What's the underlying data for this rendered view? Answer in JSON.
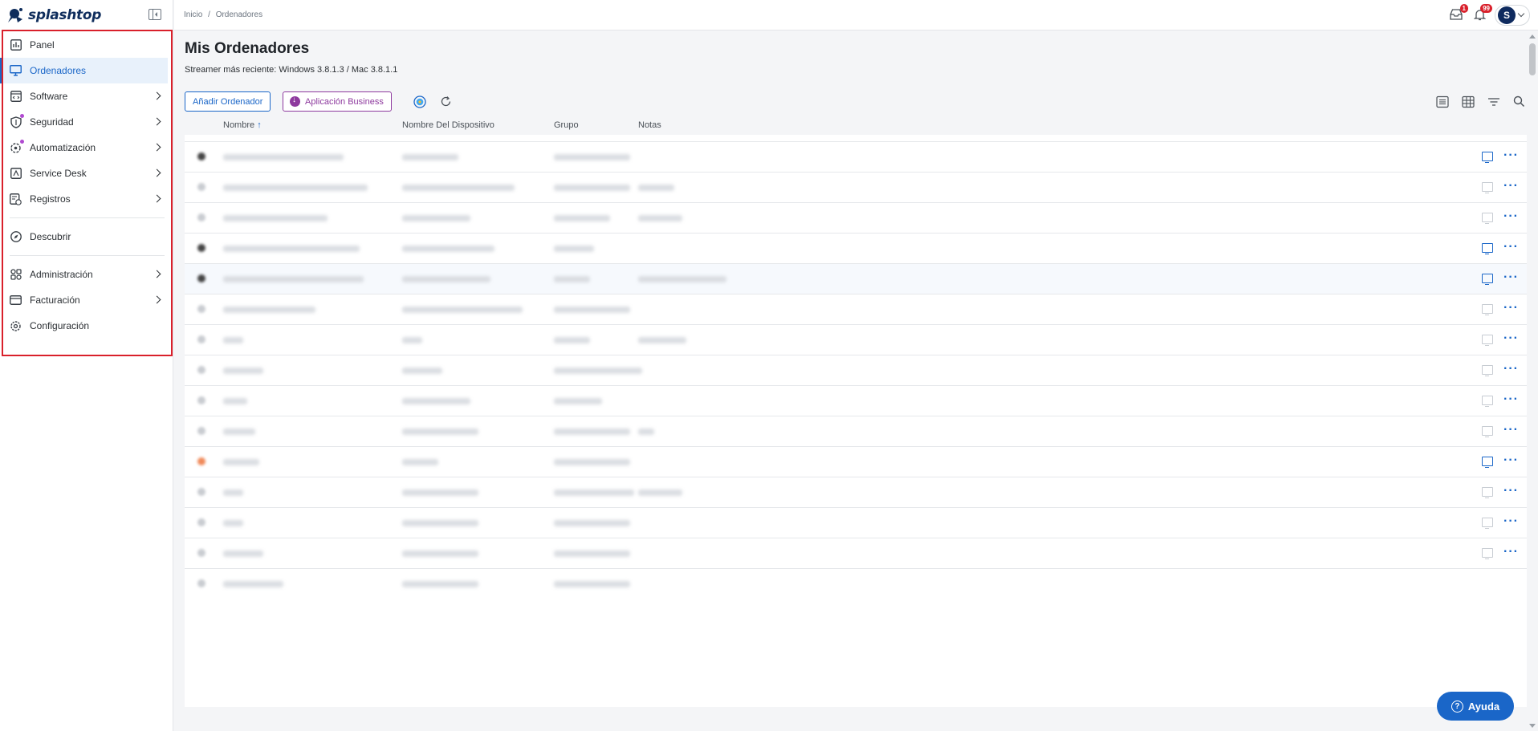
{
  "brand": {
    "name": "splashtop"
  },
  "sidebar": {
    "items": [
      {
        "label": "Panel",
        "icon": "chart-icon",
        "active": false,
        "has_chevron": false
      },
      {
        "label": "Ordenadores",
        "icon": "monitor-icon",
        "active": true,
        "has_chevron": false
      },
      {
        "label": "Software",
        "icon": "code-window-icon",
        "active": false,
        "has_chevron": true
      },
      {
        "label": "Seguridad",
        "icon": "shield-icon",
        "active": false,
        "has_chevron": true
      },
      {
        "label": "Automatización",
        "icon": "automation-icon",
        "active": false,
        "has_chevron": true
      },
      {
        "label": "Service Desk",
        "icon": "service-desk-icon",
        "active": false,
        "has_chevron": true
      },
      {
        "label": "Registros",
        "icon": "logs-icon",
        "active": false,
        "has_chevron": true
      },
      {
        "label": "Descubrir",
        "icon": "compass-icon",
        "active": false,
        "has_chevron": false
      },
      {
        "label": "Administración",
        "icon": "admin-icon",
        "active": false,
        "has_chevron": true
      },
      {
        "label": "Facturación",
        "icon": "card-icon",
        "active": false,
        "has_chevron": true
      },
      {
        "label": "Configuración",
        "icon": "gear-icon",
        "active": false,
        "has_chevron": false
      }
    ]
  },
  "topbar": {
    "breadcrumb": [
      "Inicio",
      "/",
      "Ordenadores"
    ],
    "inbox_badge": "1",
    "notifications_badge": "99",
    "avatar_initial": "S"
  },
  "main": {
    "title": "Mis Ordenadores",
    "subtitle": "Streamer más reciente: Windows 3.8.1.3 / Mac 3.8.1.1",
    "add_button": "Añadir Ordenador",
    "business_button": "Aplicación Business",
    "columns": {
      "name": "Nombre",
      "device": "Nombre Del Dispositivo",
      "group": "Grupo",
      "notes": "Notas"
    }
  },
  "help": {
    "label": "Ayuda"
  },
  "colors": {
    "accent": "#1a66c8",
    "brand_dark": "#0f2d5c",
    "business": "#8e3a9e",
    "highlight": "#d9202b"
  }
}
